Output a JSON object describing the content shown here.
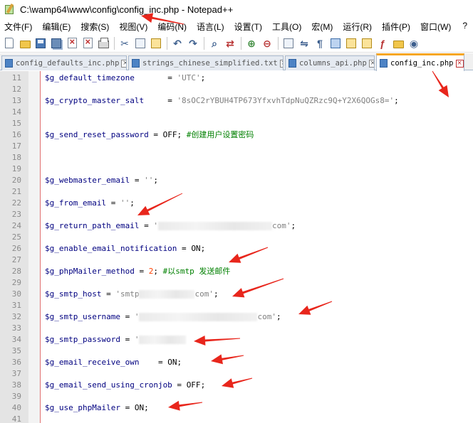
{
  "window": {
    "title": "C:\\wamp64\\www\\config\\config_inc.php - Notepad++"
  },
  "menu": [
    "文件(F)",
    "编辑(E)",
    "搜索(S)",
    "视图(V)",
    "编码(N)",
    "语言(L)",
    "设置(T)",
    "工具(O)",
    "宏(M)",
    "运行(R)",
    "插件(P)",
    "窗口(W)"
  ],
  "menu_help": "?",
  "toolbar_icons": [
    "new-file-icon",
    "open-folder-icon",
    "save-icon",
    "save-all-icon",
    "close-file-icon",
    "close-all-icon",
    "print-icon",
    "cut-icon",
    "copy-icon",
    "paste-icon",
    "undo-icon",
    "redo-icon",
    "find-icon",
    "replace-icon",
    "zoom-in-icon",
    "zoom-out-icon",
    "sync-scroll-icon",
    "wrap-icon",
    "show-all-chars-icon",
    "indent-guide-icon",
    "user-lang-icon",
    "doc-map-icon",
    "function-list-icon",
    "folder-workspace-icon",
    "monitor-icon"
  ],
  "tabs": [
    {
      "label": "config_defaults_inc.php",
      "active": false
    },
    {
      "label": "strings_chinese_simplified.txt",
      "active": false
    },
    {
      "label": "columns_api.php",
      "active": false
    },
    {
      "label": "config_inc.php",
      "active": true
    }
  ],
  "tab_close_glyph": "×",
  "editor": {
    "lines": [
      {
        "n": "11",
        "var": "$g_default_timezone",
        "pad": "       ",
        "eq": "=",
        "val": "'UTC'",
        "val_type": "str",
        "tail": ";",
        "comment": ""
      },
      {
        "n": "12",
        "var": "",
        "pad": "",
        "eq": "",
        "val": "",
        "val_type": "",
        "tail": "",
        "comment": ""
      },
      {
        "n": "13",
        "var": "$g_crypto_master_salt",
        "pad": "     ",
        "eq": "=",
        "val": "'8sOC2rYBUH4TP673YfxvhTdpNuQZRzc9Q+Y2X6QOGs8='",
        "val_type": "str",
        "tail": ";",
        "comment": ""
      },
      {
        "n": "14",
        "var": "",
        "pad": "",
        "eq": "",
        "val": "",
        "val_type": "",
        "tail": "",
        "comment": ""
      },
      {
        "n": "15",
        "var": "",
        "pad": "",
        "eq": "",
        "val": "",
        "val_type": "",
        "tail": "",
        "comment": ""
      },
      {
        "n": "16",
        "var": "$g_send_reset_password",
        "pad": " ",
        "eq": "=",
        "val": "OFF",
        "val_type": "kw",
        "tail": ";",
        "comment": "#创建用户设置密码"
      },
      {
        "n": "17",
        "var": "",
        "pad": "",
        "eq": "",
        "val": "",
        "val_type": "",
        "tail": "",
        "comment": ""
      },
      {
        "n": "18",
        "var": "",
        "pad": "",
        "eq": "",
        "val": "",
        "val_type": "",
        "tail": "",
        "comment": ""
      },
      {
        "n": "19",
        "var": "",
        "pad": "",
        "eq": "",
        "val": "",
        "val_type": "",
        "tail": "",
        "comment": ""
      },
      {
        "n": "20",
        "var": "$g_webmaster_email",
        "pad": " ",
        "eq": "=",
        "val": "''",
        "val_type": "str",
        "tail": ";",
        "comment": ""
      },
      {
        "n": "21",
        "var": "",
        "pad": "",
        "eq": "",
        "val": "",
        "val_type": "",
        "tail": "",
        "comment": ""
      },
      {
        "n": "22",
        "var": "$g_from_email",
        "pad": " ",
        "eq": "=",
        "val": "''",
        "val_type": "str",
        "tail": ";",
        "comment": ""
      },
      {
        "n": "23",
        "var": "",
        "pad": "",
        "eq": "",
        "val": "",
        "val_type": "",
        "tail": "",
        "comment": ""
      },
      {
        "n": "24",
        "var": "$g_return_path_email",
        "pad": " ",
        "eq": "=",
        "val": "'",
        "val_type": "str",
        "redact": 1,
        "val2": "com'",
        "tail": ";",
        "comment": ""
      },
      {
        "n": "25",
        "var": "",
        "pad": "",
        "eq": "",
        "val": "",
        "val_type": "",
        "tail": "",
        "comment": ""
      },
      {
        "n": "26",
        "var": "$g_enable_email_notification",
        "pad": " ",
        "eq": "=",
        "val": "ON",
        "val_type": "kw",
        "tail": ";",
        "comment": ""
      },
      {
        "n": "27",
        "var": "",
        "pad": "",
        "eq": "",
        "val": "",
        "val_type": "",
        "tail": "",
        "comment": ""
      },
      {
        "n": "28",
        "var": "$g_phpMailer_method",
        "pad": " ",
        "eq": "=",
        "val": "2",
        "val_type": "num",
        "tail": ";",
        "comment": "#以smtp 发送邮件"
      },
      {
        "n": "29",
        "var": "",
        "pad": "",
        "eq": "",
        "val": "",
        "val_type": "",
        "tail": "",
        "comment": ""
      },
      {
        "n": "30",
        "var": "$g_smtp_host",
        "pad": " ",
        "eq": "=",
        "val": "'smtp",
        "val_type": "str",
        "redact": 2,
        "val2": "com'",
        "tail": ";",
        "comment": ""
      },
      {
        "n": "31",
        "var": "",
        "pad": "",
        "eq": "",
        "val": "",
        "val_type": "",
        "tail": "",
        "comment": ""
      },
      {
        "n": "32",
        "var": "$g_smtp_username",
        "pad": " ",
        "eq": "=",
        "val": "'",
        "val_type": "str",
        "redact": 3,
        "val2": "com'",
        "tail": ";",
        "comment": ""
      },
      {
        "n": "33",
        "var": "",
        "pad": "",
        "eq": "",
        "val": "",
        "val_type": "",
        "tail": "",
        "comment": ""
      },
      {
        "n": "34",
        "var": "$g_smtp_password",
        "pad": " ",
        "eq": "=",
        "val": "'",
        "val_type": "str",
        "redact": 4,
        "val2": "",
        "tail": "",
        "comment": ""
      },
      {
        "n": "35",
        "var": "",
        "pad": "",
        "eq": "",
        "val": "",
        "val_type": "",
        "tail": "",
        "comment": ""
      },
      {
        "n": "36",
        "var": "$g_email_receive_own",
        "pad": "    ",
        "eq": "=",
        "val": "ON",
        "val_type": "kw",
        "tail": ";",
        "comment": ""
      },
      {
        "n": "37",
        "var": "",
        "pad": "",
        "eq": "",
        "val": "",
        "val_type": "",
        "tail": "",
        "comment": ""
      },
      {
        "n": "38",
        "var": "$g_email_send_using_cronjob",
        "pad": " ",
        "eq": "=",
        "val": "OFF",
        "val_type": "kw",
        "tail": ";",
        "comment": ""
      },
      {
        "n": "39",
        "var": "",
        "pad": "",
        "eq": "",
        "val": "",
        "val_type": "",
        "tail": "",
        "comment": ""
      },
      {
        "n": "40",
        "var": "$g_use_phpMailer",
        "pad": " ",
        "eq": "=",
        "val": "ON",
        "val_type": "kw",
        "tail": ";",
        "comment": ""
      },
      {
        "n": "41",
        "var": "",
        "pad": "",
        "eq": "",
        "val": "",
        "val_type": "",
        "tail": "",
        "comment": ""
      }
    ]
  },
  "colors": {
    "variable": "#000080",
    "string": "#808080",
    "number": "#ff4000",
    "comment": "#008000",
    "active_tab_accent": "#f6a623",
    "annotation_arrow": "#e8261c"
  }
}
